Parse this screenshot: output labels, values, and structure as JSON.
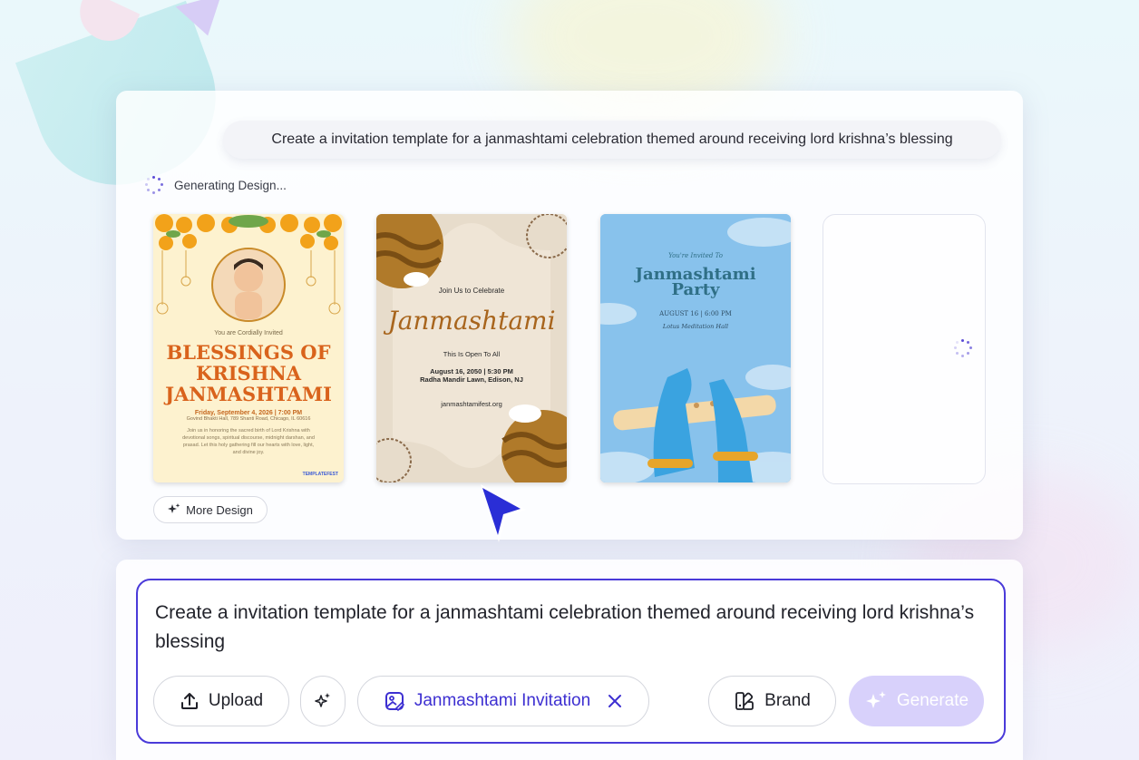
{
  "prompt_bubble": "Create a invitation template for a janmashtami celebration themed around receiving lord krishna’s blessing",
  "status": "Generating Design...",
  "cards": {
    "card1": {
      "invited": "You are Cordially Invited",
      "title_l1": "BLESSINGS OF",
      "title_l2": "KRISHNA",
      "title_l3": "JANMASHTAMI",
      "date": "Friday, September 4, 2026 | 7:00 PM",
      "venue": "Govind Bhakti Hall, 789 Shanti Road, Chicago, IL 60616",
      "body_l1": "Join us in honoring the sacred birth of Lord Krishna with",
      "body_l2": "devotional songs, spiritual discourse, midnight darshan, and",
      "body_l3": "prasad. Let this holy gathering fill our hearts with love, light,",
      "body_l4": "and divine joy.",
      "badge": "TEMPLATEFEST"
    },
    "card2": {
      "join": "Join Us to Celebrate",
      "title": "Janmashtami",
      "open": "This Is Open To All",
      "date": "August 16, 2050 | 5:30 PM",
      "venue": "Radha Mandir Lawn, Edison, NJ",
      "url": "janmashtamifest.org"
    },
    "card3": {
      "invited": "You're Invited To",
      "title_l1": "Janmashtami",
      "title_l2": "Party",
      "date": "AUGUST 16 | 6:00 PM",
      "venue": "Lotus Meditation Hall"
    }
  },
  "more_design_label": "More Design",
  "composer": {
    "text": "Create a invitation template for a janmashtami celebration themed around receiving lord krishna’s blessing",
    "upload_label": "Upload",
    "chip_label": "Janmashtami Invitation",
    "brand_label": "Brand",
    "generate_label": "Generate"
  },
  "colors": {
    "accent": "#4a3ad9",
    "generate_disabled": "#d8d1fb",
    "card1_title": "#d9631c",
    "card2_title": "#a8651d",
    "card3_title": "#2f6f86"
  },
  "icons": [
    "spinner-icon",
    "sparkle-icon",
    "upload-icon",
    "magic-icon",
    "image-edit-icon",
    "close-icon",
    "brand-icon",
    "cursor-arrow-icon"
  ]
}
